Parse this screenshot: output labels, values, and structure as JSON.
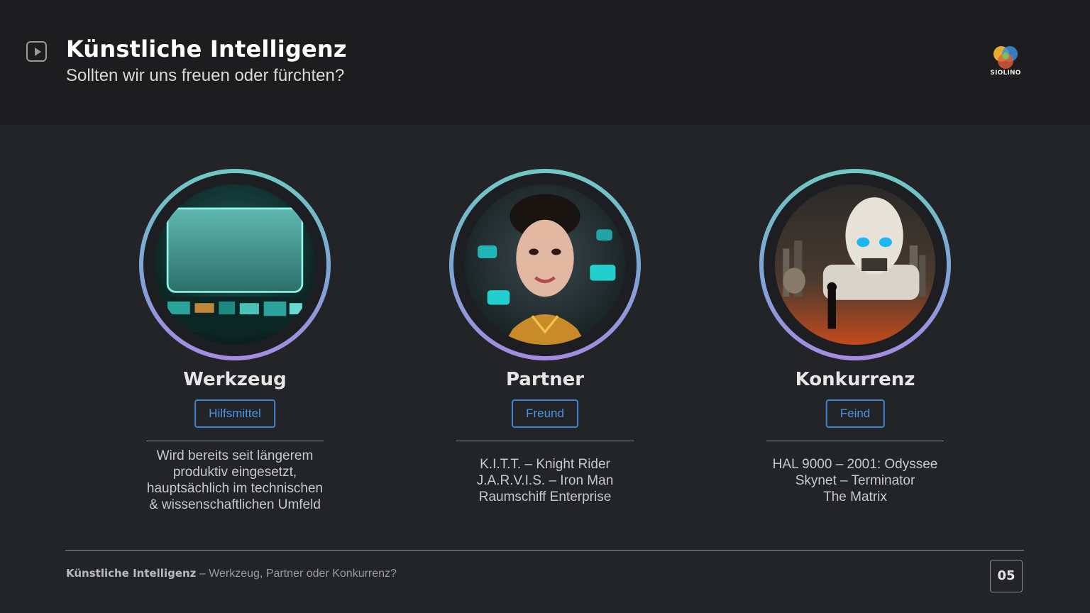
{
  "header": {
    "title": "Künstliche Intelligenz",
    "subtitle": "Sollten wir uns freuen oder fürchten?",
    "logo_text": "SIOLINO"
  },
  "columns": [
    {
      "title": "Werkzeug",
      "tag": "Hilfsmittel",
      "lines": [
        "Wird bereits seit längerem",
        "produktiv eingesetzt,",
        "hauptsächlich im technischen",
        "& wissenschaftlichen Umfeld"
      ]
    },
    {
      "title": "Partner",
      "tag": "Freund",
      "lines": [
        "K.I.T.T. – Knight Rider",
        "J.A.R.V.I.S. – Iron Man",
        "Raumschiff Enterprise"
      ]
    },
    {
      "title": "Konkurrenz",
      "tag": "Feind",
      "lines": [
        "HAL 9000 – 2001: Odyssee",
        "Skynet – Terminator",
        "The Matrix"
      ]
    }
  ],
  "footer": {
    "title_bold": "Künstliche Intelligenz",
    "title_rest": " – Werkzeug, Partner oder Konkurrenz?",
    "page": "05"
  },
  "colors": {
    "background": "#222428",
    "header_bg": "#1d1d1f",
    "accent": "#3f86d1"
  }
}
